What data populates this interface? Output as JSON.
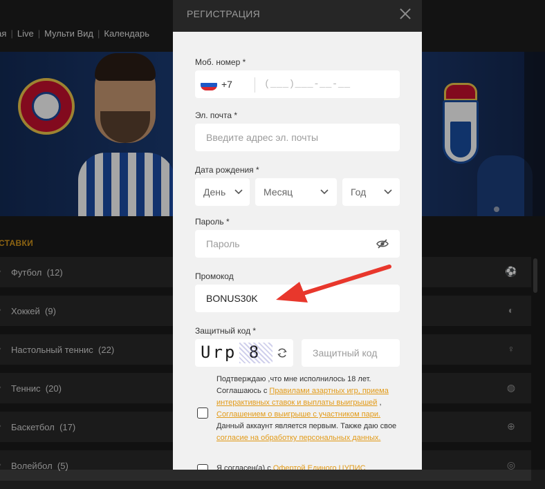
{
  "site": {
    "nav": [
      "ная",
      "Live",
      "Мульти Вид",
      "Календарь"
    ],
    "section_title": "СТАВКИ",
    "sports": [
      {
        "name": "Футбол",
        "count": "(12)",
        "icon": "soccer-ball-icon"
      },
      {
        "name": "Хоккей",
        "count": "(9)",
        "icon": "hockey-puck-icon"
      },
      {
        "name": "Настольный теннис",
        "count": "(22)",
        "icon": "table-tennis-icon"
      },
      {
        "name": "Теннис",
        "count": "(20)",
        "icon": "tennis-ball-icon"
      },
      {
        "name": "Баскетбол",
        "count": "(17)",
        "icon": "basketball-icon"
      },
      {
        "name": "Волейбол",
        "count": "(5)",
        "icon": "volleyball-icon"
      }
    ],
    "accent_color": "#f3a71c"
  },
  "modal": {
    "title": "РЕГИСТРАЦИЯ",
    "phone": {
      "label": "Моб. номер *",
      "code": "+7",
      "mask": "(___)___-__-__"
    },
    "email": {
      "label": "Эл. почта *",
      "placeholder": "Введите адрес эл. почты"
    },
    "birth": {
      "label": "Дата рождения *",
      "day": "День",
      "month": "Месяц",
      "year": "Год"
    },
    "password": {
      "label": "Пароль *",
      "placeholder": "Пароль"
    },
    "promo": {
      "label": "Промокод",
      "value": "BONUS30K"
    },
    "captcha": {
      "label": "Защитный код *",
      "image_text": "Urp 8",
      "placeholder": "Защитный код"
    },
    "terms": {
      "t1": "Подтверждаю ,что мне исполнилось 18 лет. Соглашаюсь с ",
      "l1": "Правилами азартных игр, приема интерактивных ставок и выплаты выигрышей",
      "t2": " , ",
      "l2": "Соглашением о выигрыше с участником пари.",
      "t3": " Данный аккаунт является первым. Также даю свое ",
      "l3": "согласие на обработку персональных данных.",
      "t4": ""
    },
    "terms2": {
      "t1": "Я согласен(а) с ",
      "l1": "Офертой Единого ЦУПИС"
    }
  }
}
